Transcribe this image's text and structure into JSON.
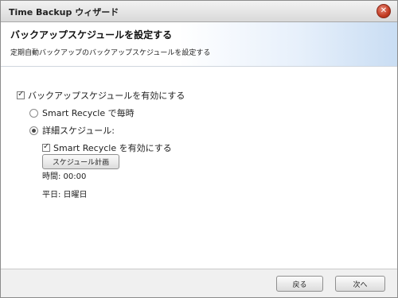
{
  "window": {
    "title": "Time Backup ウィザード",
    "close_glyph": "✕"
  },
  "header": {
    "title": "バックアップスケジュールを設定する",
    "subtitle": "定期自動バックアップのバックアップスケジュールを設定する"
  },
  "content": {
    "enable_schedule_label": "バックアップスケジュールを有効にする",
    "enable_schedule_checked": true,
    "radio_smart_recycle_label": "Smart Recycle で毎時",
    "radio_detailed_label": "詳細スケジュール:",
    "selected_option": "detailed",
    "enable_smart_recycle_label": "Smart Recycle を有効にする",
    "enable_smart_recycle_checked": true,
    "schedule_plan_button": "スケジュール計画",
    "time_line": "時間: 00:00",
    "weekday_line": "平日: 日曜日"
  },
  "footer": {
    "back_button": "戻る",
    "next_button": "次へ"
  }
}
